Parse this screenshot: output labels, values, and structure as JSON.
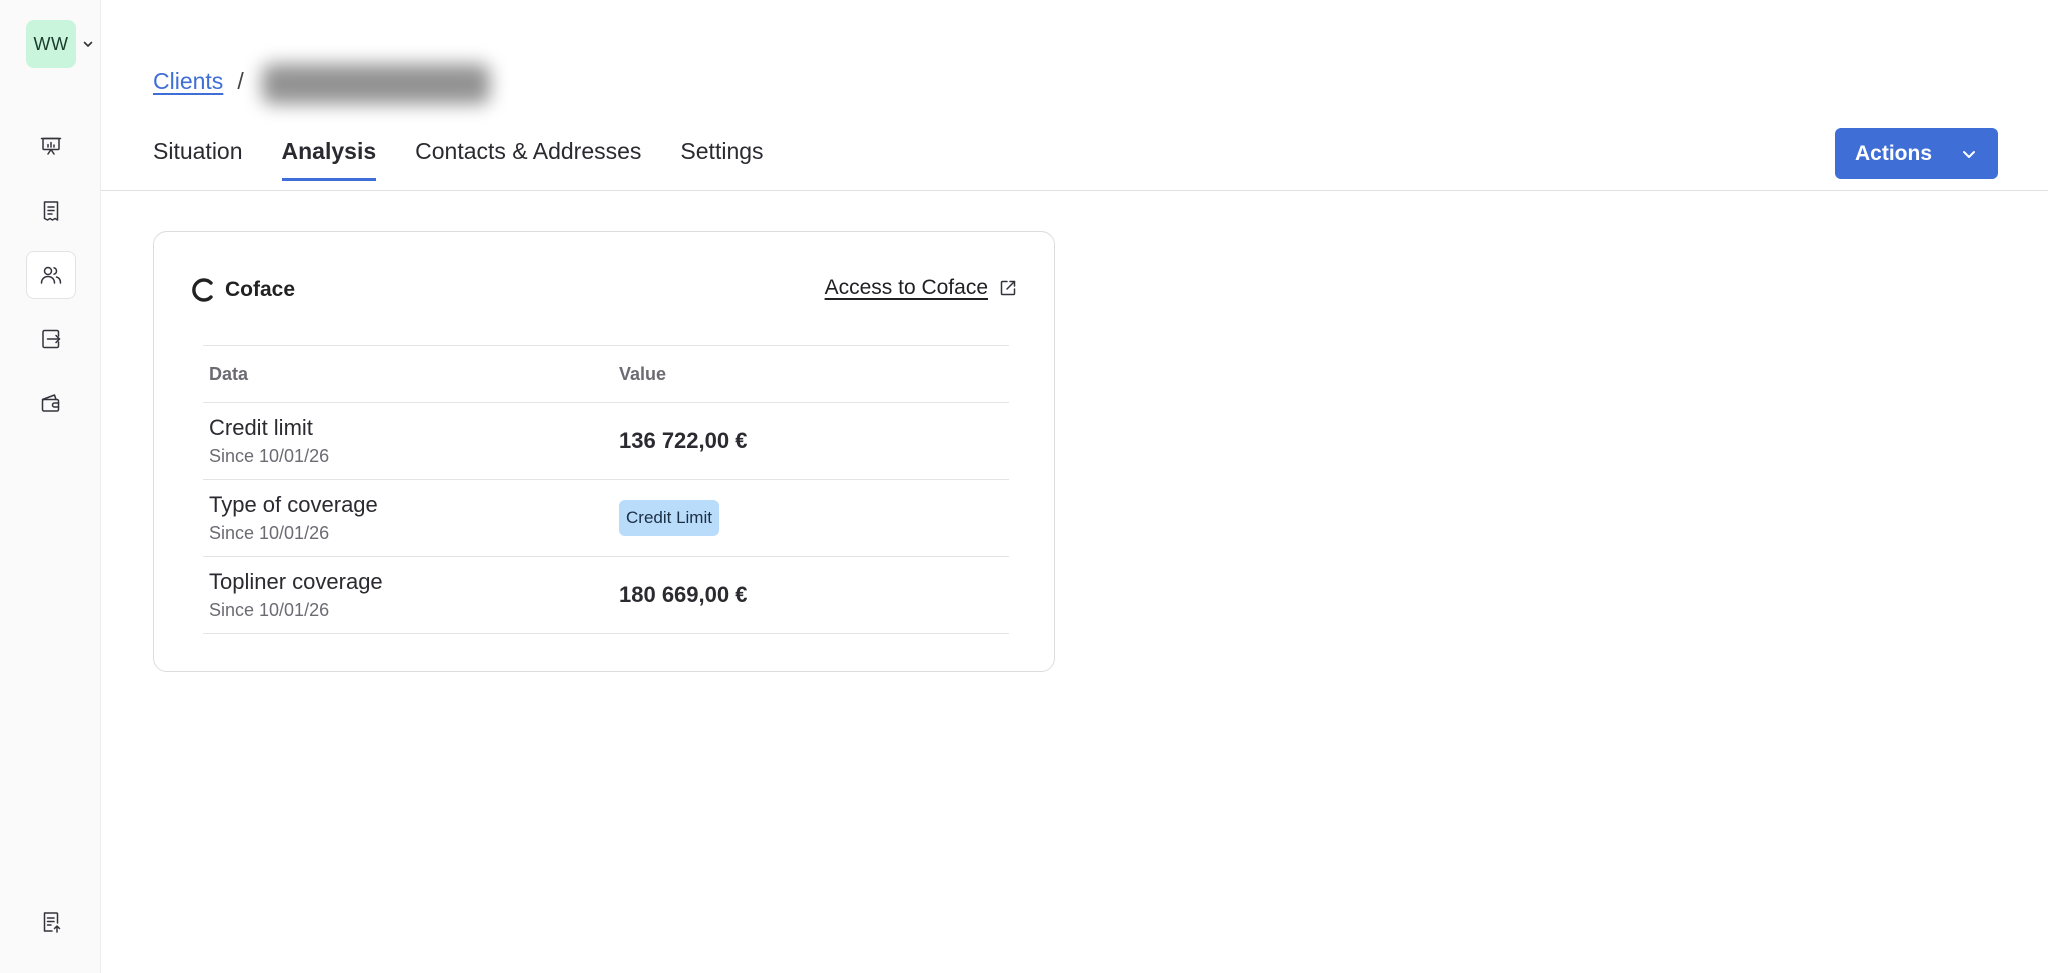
{
  "workspace": {
    "initials": "WW"
  },
  "sidebar": {
    "items": [
      {
        "name": "presentation-icon"
      },
      {
        "name": "receipt-icon"
      },
      {
        "name": "users-icon",
        "active": true
      },
      {
        "name": "export-icon"
      },
      {
        "name": "wallet-icon"
      },
      {
        "name": "document-upload-icon"
      }
    ]
  },
  "breadcrumb": {
    "parent": "Clients",
    "separator": "/"
  },
  "tabs": [
    {
      "label": "Situation"
    },
    {
      "label": "Analysis",
      "active": true
    },
    {
      "label": "Contacts & Addresses"
    },
    {
      "label": "Settings"
    }
  ],
  "actions": {
    "label": "Actions"
  },
  "coface": {
    "name": "Coface",
    "access_link": "Access to Coface",
    "columns": {
      "data": "Data",
      "value": "Value"
    },
    "rows": [
      {
        "label": "Credit limit",
        "since": "Since 10/01/26",
        "value": "136 722,00 €"
      },
      {
        "label": "Type of coverage",
        "since": "Since 10/01/26",
        "value": "Credit Limit"
      },
      {
        "label": "Topliner coverage",
        "since": "Since 10/01/26",
        "value": "180 669,00 €"
      }
    ]
  },
  "colors": {
    "accent": "#3e6ed6",
    "badge": "#b8dcfa",
    "avatar": "#c8f5dc"
  }
}
